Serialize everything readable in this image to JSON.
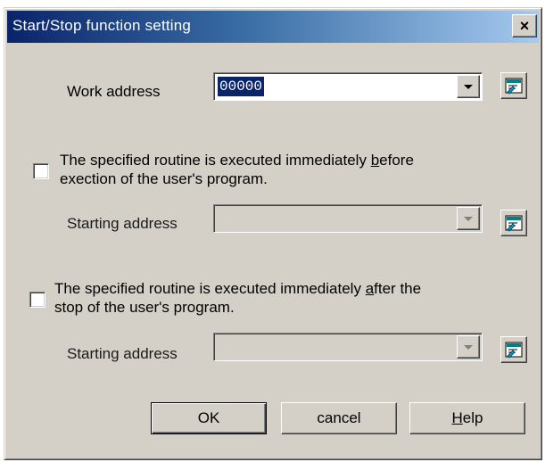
{
  "window": {
    "title": "Start/Stop function setting",
    "close_label": "×"
  },
  "work_address": {
    "label": "Work address",
    "value": "00000"
  },
  "before_section": {
    "checked": false,
    "text_prefix": "The specified routine is executed immediately ",
    "text_mnemonic": "b",
    "text_suffix": "efore",
    "text_line2": "exection of the user's program.",
    "starting_address_label": "Starting address",
    "value": ""
  },
  "after_section": {
    "checked": false,
    "text_prefix": "The specified routine is executed immediately ",
    "text_mnemonic": "a",
    "text_suffix": "fter the",
    "text_line2": "stop of the user's program.",
    "starting_address_label": "Starting address",
    "value": ""
  },
  "buttons": {
    "ok": "OK",
    "cancel": "cancel",
    "help_mnemonic": "H",
    "help_rest": "elp"
  },
  "icons": {
    "reference_button": "address-reference-icon",
    "combo_arrow": "chevron-down-icon"
  },
  "colors": {
    "titlebar_start": "#0a246a",
    "titlebar_end": "#a6caf0",
    "face": "#d4d0c8",
    "selection": "#0a246a"
  }
}
